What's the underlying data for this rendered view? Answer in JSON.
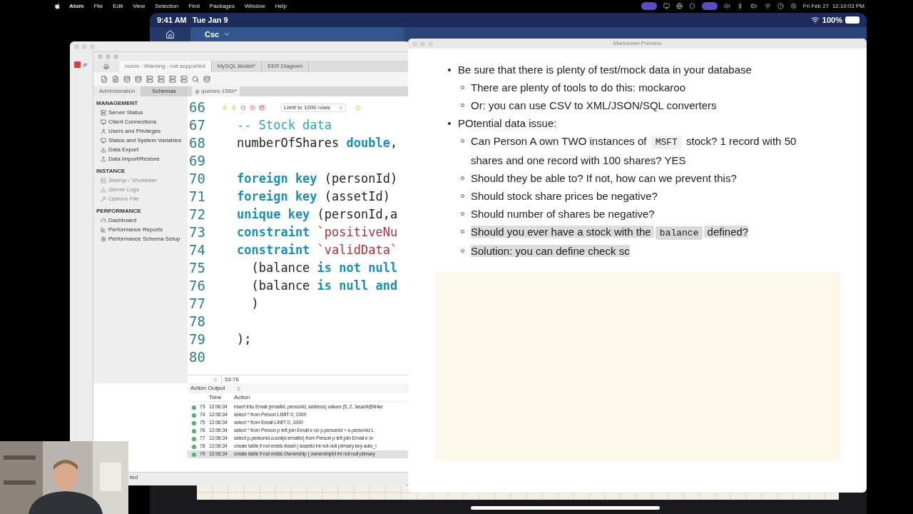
{
  "menubar": {
    "app": "Atom",
    "items": [
      "File",
      "Edit",
      "View",
      "Selection",
      "Find",
      "Packages",
      "Window",
      "Help"
    ],
    "clock": "Fri Feb 27  12:10:03 PM"
  },
  "tablet": {
    "time": "9:41 AM",
    "date": "Tue Jan 9",
    "battery": "100%",
    "tab": "Csc"
  },
  "back_window": {
    "label": "P",
    "status": "ted"
  },
  "workbench": {
    "tabs": [
      {
        "label": "nuros - Warning - not supported",
        "selected": true
      },
      {
        "label": "MySQL Model*",
        "selected": false
      },
      {
        "label": "EER Diagram",
        "selected": false
      }
    ],
    "sidebar_tabs": [
      {
        "label": "Administration",
        "selected": true
      },
      {
        "label": "Schemas",
        "selected": false
      }
    ],
    "query_tab": "queries-156h*",
    "sections": [
      {
        "title": "MANAGEMENT",
        "items": [
          {
            "label": "Server Status",
            "disabled": false
          },
          {
            "label": "Client Connections",
            "disabled": false
          },
          {
            "label": "Users and Privileges",
            "disabled": false
          },
          {
            "label": "Status and System Variables",
            "disabled": false
          },
          {
            "label": "Data Export",
            "disabled": false
          },
          {
            "label": "Data Import/Restore",
            "disabled": false
          }
        ]
      },
      {
        "title": "INSTANCE",
        "items": [
          {
            "label": "Startup / Shutdown",
            "disabled": true
          },
          {
            "label": "Server Logs",
            "disabled": true
          },
          {
            "label": "Options File",
            "disabled": true
          }
        ]
      },
      {
        "title": "PERFORMANCE",
        "items": [
          {
            "label": "Dashboard",
            "disabled": false
          },
          {
            "label": "Performance Reports",
            "disabled": false
          },
          {
            "label": "Performance Schema Setup",
            "disabled": false
          }
        ]
      }
    ],
    "limit": "Limit to 1000 rows",
    "lines": [
      {
        "number": "66"
      },
      {
        "number": "67",
        "tokens": [
          {
            "kind": "comment",
            "text": "-- Stock data"
          }
        ]
      },
      {
        "number": "68",
        "tokens": [
          {
            "kind": "plain",
            "text": "numberOfShares "
          },
          {
            "kind": "keyword",
            "text": "double"
          },
          {
            "kind": "plain",
            "text": ","
          }
        ]
      },
      {
        "number": "69"
      },
      {
        "number": "70",
        "tokens": [
          {
            "kind": "keyword",
            "text": "foreign key"
          },
          {
            "kind": "plain",
            "text": " (personId)"
          }
        ]
      },
      {
        "number": "71",
        "tokens": [
          {
            "kind": "keyword",
            "text": "foreign key"
          },
          {
            "kind": "plain",
            "text": " (assetId)"
          }
        ]
      },
      {
        "number": "72",
        "tokens": [
          {
            "kind": "keyword",
            "text": "unique key"
          },
          {
            "kind": "plain",
            "text": " (personId,a"
          }
        ]
      },
      {
        "number": "73",
        "tokens": [
          {
            "kind": "keyword",
            "text": "constraint"
          },
          {
            "kind": "string",
            "text": " `positiveNu"
          }
        ]
      },
      {
        "number": "74",
        "tokens": [
          {
            "kind": "keyword",
            "text": "constraint"
          },
          {
            "kind": "string",
            "text": " `validData`"
          }
        ]
      },
      {
        "number": "75",
        "tokens": [
          {
            "kind": "plain",
            "text": "  (balance "
          },
          {
            "kind": "keyword",
            "text": "is not null"
          }
        ]
      },
      {
        "number": "76",
        "tokens": [
          {
            "kind": "plain",
            "text": "  (balance "
          },
          {
            "kind": "keyword",
            "text": "is null and"
          }
        ]
      },
      {
        "number": "77",
        "tokens": [
          {
            "kind": "plain",
            "text": "  )"
          }
        ]
      },
      {
        "number": "78"
      },
      {
        "number": "79",
        "tokens": [
          {
            "kind": "plain",
            "text": ");"
          }
        ]
      },
      {
        "number": "80"
      }
    ],
    "position": "53:76",
    "output": {
      "title": "Action Output",
      "columns": [
        "Time",
        "Action"
      ],
      "rows": [
        {
          "number": "73",
          "time": "12:06:34",
          "action": "insert into Email (emailId, personId, address) values (5, 2, 'aead4@linke",
          "selected": false
        },
        {
          "number": "74",
          "time": "12:06:34",
          "action": "select * from Person LIMIT 0, 1000",
          "selected": false
        },
        {
          "number": "75",
          "time": "12:06:34",
          "action": "select * from Email LIMIT 0, 1000",
          "selected": false
        },
        {
          "number": "76",
          "time": "12:06:34",
          "action": "select * from Person p    left join Email e    on p.personId = e.personId L",
          "selected": false
        },
        {
          "number": "77",
          "time": "12:06:34",
          "action": "select p.personId,count(e.emailId) from Person p    left join Email e    or",
          "selected": false
        },
        {
          "number": "78",
          "time": "12:06:34",
          "action": "create table if not exists Asset (    assetId int not null primary key auto_i",
          "selected": false
        },
        {
          "number": "79",
          "time": "12:06:34",
          "action": "create table if not exists Ownership (    ownershipId int not null primary",
          "selected": true
        }
      ]
    }
  },
  "preview": {
    "title": "Markdown Preview",
    "items": [
      {
        "parts": [
          {
            "kind": "text",
            "text": "Be sure that there is plenty of test/mock data in your database"
          }
        ],
        "children": [
          {
            "parts": [
              {
                "kind": "text",
                "text": "There are plenty of tools to do this: mockaroo"
              }
            ],
            "highlighted": false
          },
          {
            "parts": [
              {
                "kind": "text",
                "text": "Or: you can use CSV to XML/JSON/SQL converters"
              }
            ],
            "highlighted": false
          }
        ]
      },
      {
        "parts": [
          {
            "kind": "text",
            "text": "POtential data issue:"
          }
        ],
        "children": [
          {
            "parts": [
              {
                "kind": "text",
                "text": "Can Person A own TWO instances of "
              },
              {
                "kind": "code",
                "text": "MSFT"
              },
              {
                "kind": "text",
                "text": " stock? 1 record with 50 shares and one record with 100 shares? YES"
              }
            ],
            "highlighted": false
          },
          {
            "parts": [
              {
                "kind": "text",
                "text": "Should they be able to? If not, how can we prevent this?"
              }
            ],
            "highlighted": false
          },
          {
            "parts": [
              {
                "kind": "text",
                "text": "Should stock share prices be negative?"
              }
            ],
            "highlighted": false
          },
          {
            "parts": [
              {
                "kind": "text",
                "text": "Should number of shares be negative?"
              }
            ],
            "highlighted": false
          },
          {
            "parts": [
              {
                "kind": "text",
                "text": "Should you ever have a stock with the "
              },
              {
                "kind": "code",
                "text": "balance"
              },
              {
                "kind": "text",
                "text": " defined?"
              }
            ],
            "highlighted": true
          },
          {
            "parts": [
              {
                "kind": "text",
                "text": "Solution: you can define check sc"
              }
            ],
            "highlighted": true
          }
        ]
      }
    ]
  }
}
